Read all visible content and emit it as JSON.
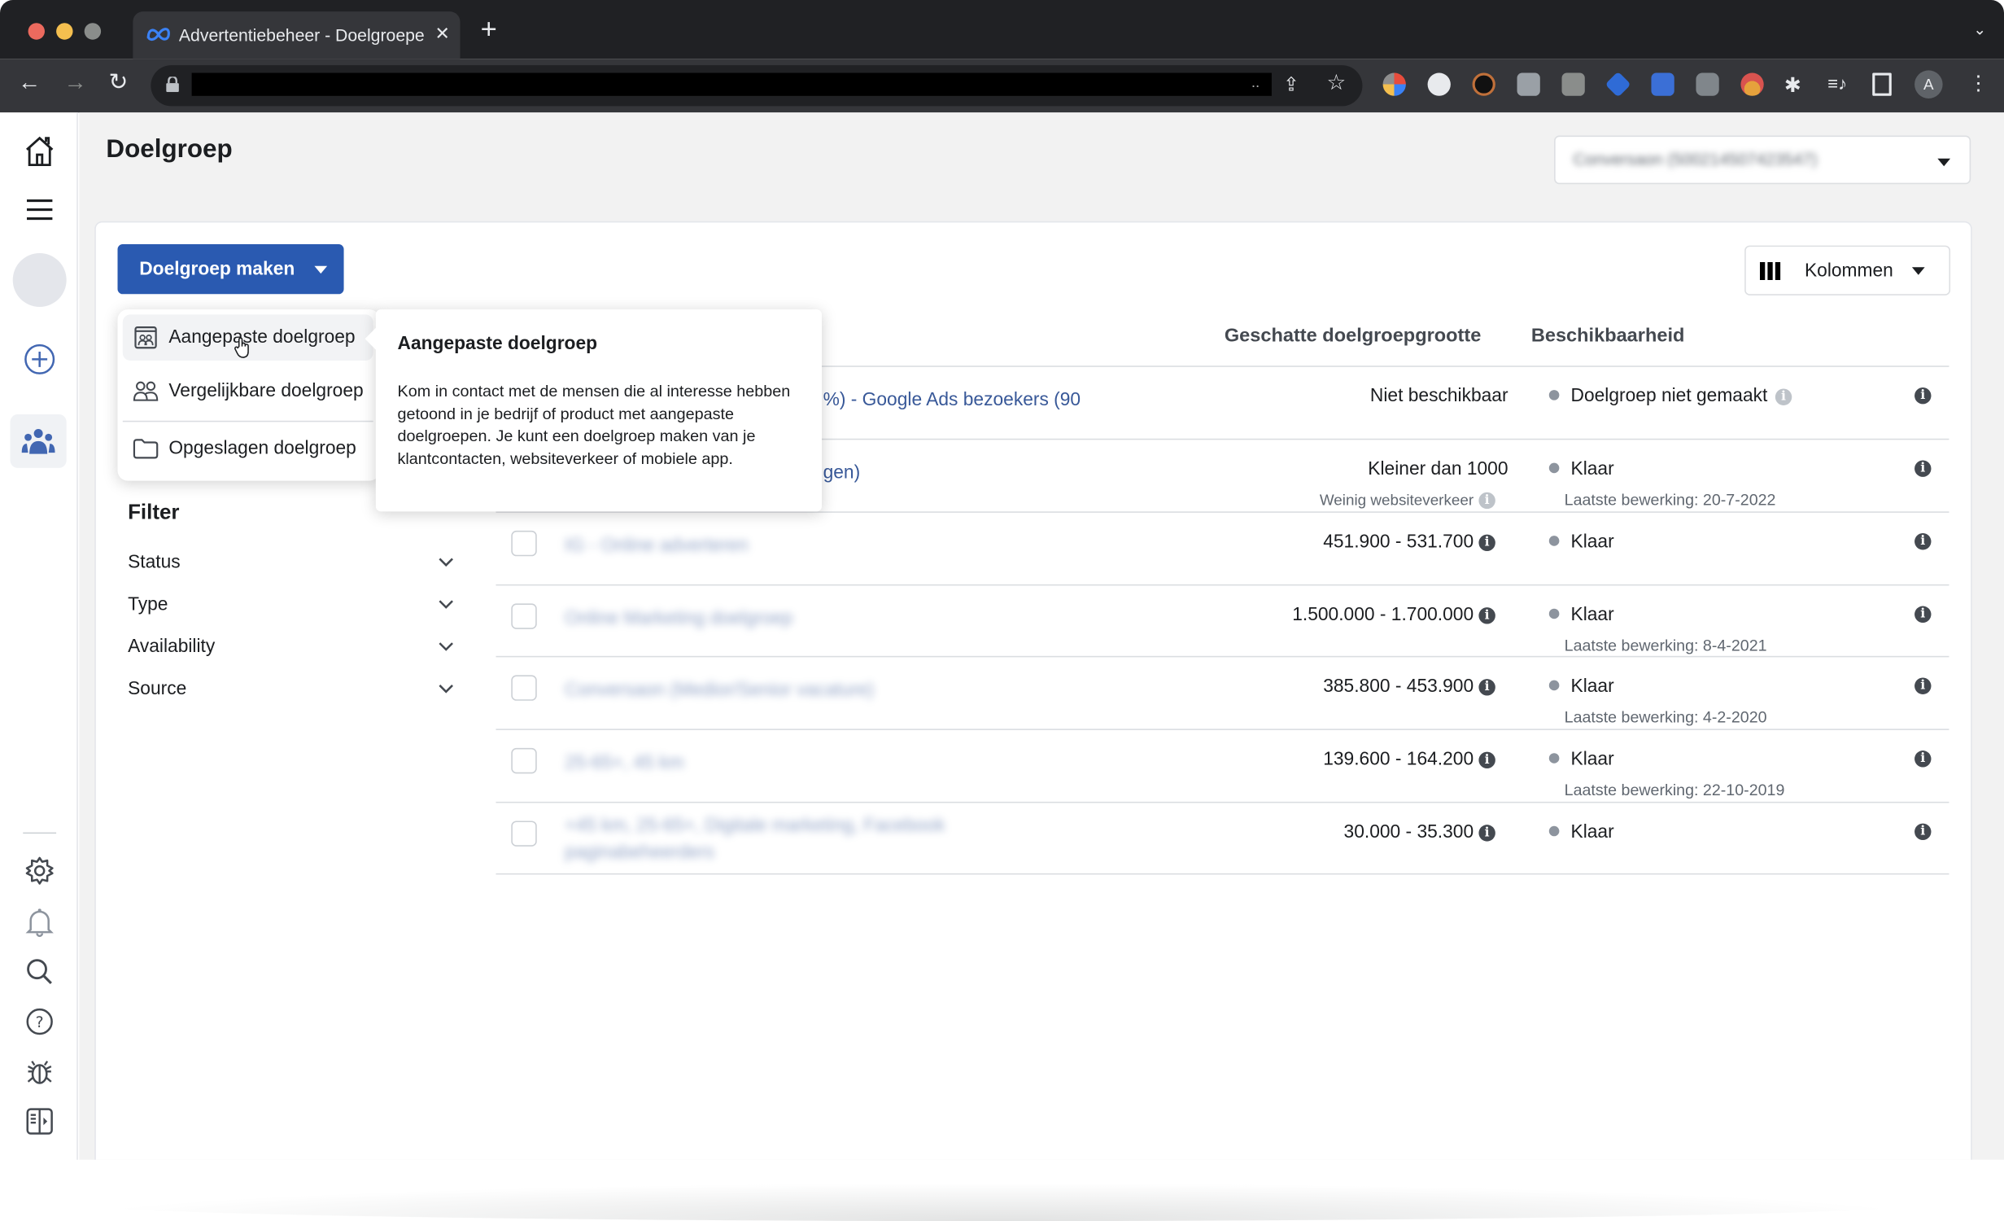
{
  "browser": {
    "tab_title": "Advertentiebeheer - Doelgroepen",
    "tab_close": "✕",
    "new_tab": "+",
    "url_hidden": true,
    "extension_icons": [
      "color-wheel-extension",
      "robot-extension",
      "circuit-extension",
      "bitwarden-extension",
      "code-extension",
      "tag-extension",
      "blue-tag-extension",
      "camera-extension",
      "santa-extension",
      "puzzle-extensions",
      "media-control",
      "side-panel"
    ],
    "profile_initial": "A"
  },
  "rail": {
    "top_items": [
      "home",
      "menu",
      "account-avatar",
      "create",
      "audiences"
    ],
    "bottom_items": [
      "settings",
      "notifications",
      "search",
      "help",
      "report-bug",
      "toggle-panel"
    ],
    "active": "audiences",
    "accent_color": "#4267b2"
  },
  "header": {
    "title": "Doelgroep",
    "account_selector_value": "Conversaon (500214507423547)"
  },
  "toolbar": {
    "create_button_label": "Doelgroep maken",
    "columns_button_label": "Kolommen"
  },
  "create_menu": {
    "items": [
      {
        "label": "Aangepaste doelgroep",
        "icon": "custom-audience-icon",
        "hovered": true
      },
      {
        "label": "Vergelijkbare doelgroep",
        "icon": "lookalike-audience-icon",
        "hovered": false
      },
      {
        "label": "Opgeslagen doelgroep",
        "icon": "folder-icon",
        "hovered": false
      }
    ]
  },
  "tooltip": {
    "title": "Aangepaste doelgroep",
    "body": "Kom in contact met de mensen die al interesse hebben getoond in je bedrijf of product met aangepaste doelgroepen. Je kunt een doelgroep maken van je klantcontacten, websiteverkeer of mobiele app."
  },
  "filter": {
    "title": "Filter",
    "items": [
      "Status",
      "Type",
      "Availability",
      "Source"
    ]
  },
  "table": {
    "columns": [
      "Geschatte doelgroepgrootte",
      "Beschikbaarheid"
    ],
    "rows": [
      {
        "name": "%) - Google Ads bezoekers (90",
        "name_blurred": false,
        "size": "Niet beschikbaar",
        "size_info": false,
        "size_note": "",
        "status": "Doelgroep niet gemaakt",
        "status_info": true,
        "edited": ""
      },
      {
        "name": "gen)",
        "name_blurred": false,
        "size": "Kleiner dan 1000",
        "size_info": false,
        "size_note": "Weinig websiteverkeer",
        "status": "Klaar",
        "status_info": false,
        "edited": "Laatste bewerking: 20-7-2022"
      },
      {
        "name": "IG - Online adverteren",
        "name_blurred": true,
        "size": "451.900 - 531.700",
        "size_info": true,
        "size_note": "",
        "status": "Klaar",
        "status_info": false,
        "edited": ""
      },
      {
        "name": "Online Marketing doelgroep",
        "name_blurred": true,
        "size": "1.500.000 - 1.700.000",
        "size_info": true,
        "size_note": "",
        "status": "Klaar",
        "status_info": false,
        "edited": "Laatste bewerking: 8-4-2021"
      },
      {
        "name": "Conversaon (Medior/Senior vacature)",
        "name_blurred": true,
        "size": "385.800 - 453.900",
        "size_info": true,
        "size_note": "",
        "status": "Klaar",
        "status_info": false,
        "edited": "Laatste bewerking: 4-2-2020"
      },
      {
        "name": "25-65+, 45 km",
        "name_blurred": true,
        "size": "139.600 - 164.200",
        "size_info": true,
        "size_note": "",
        "status": "Klaar",
        "status_info": false,
        "edited": "Laatste bewerking: 22-10-2019"
      },
      {
        "name": "+45 km, 25-65+, Digitale marketing, Facebook paginabeheerders",
        "name_blurred": true,
        "size": "30.000 - 35.300",
        "size_info": true,
        "size_note": "",
        "status": "Klaar",
        "status_info": false,
        "edited": ""
      }
    ]
  },
  "icons": {
    "info": "i"
  }
}
